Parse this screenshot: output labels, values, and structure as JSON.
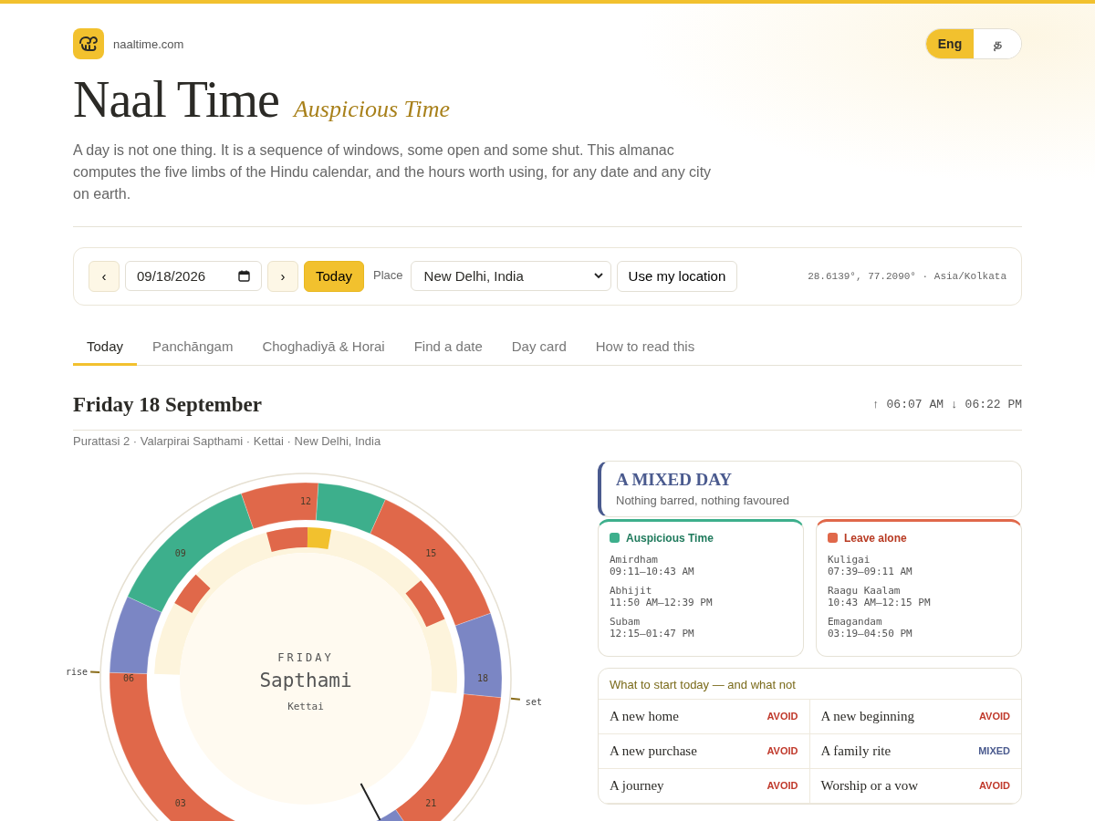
{
  "site": {
    "domain": "naaltime.com"
  },
  "languages": [
    {
      "label": "Eng",
      "selected": true
    },
    {
      "label": "த",
      "selected": false
    }
  ],
  "title": "Naal Time",
  "subtitle": "Auspicious Time",
  "intro": "A day is not one thing. It is a sequence of windows, some open and some shut. This almanac computes the five limbs of the Hindu calendar, and the hours worth using, for any date and any city on earth.",
  "controls": {
    "prev": "‹",
    "date": "09/18/2026",
    "next": "›",
    "today": "Today",
    "place_label": "Place",
    "place": "New Delhi, India",
    "locate": "Use my location",
    "coords": "28.6139°, 77.2090° · Asia/Kolkata"
  },
  "tabs": [
    {
      "label": "Today",
      "selected": true
    },
    {
      "label": "Panchāngam",
      "selected": false
    },
    {
      "label": "Choghadiyā & Horai",
      "selected": false
    },
    {
      "label": "Find a date",
      "selected": false
    },
    {
      "label": "Day card",
      "selected": false
    },
    {
      "label": "How to read this",
      "selected": false
    }
  ],
  "day": {
    "heading": "Friday 18 September",
    "sunrise": "↑ 06:07 AM",
    "sunset": "↓ 06:22 PM",
    "summary": "Purattasi 2 · Valarpirai Sapthami · Kettai · New Delhi, India"
  },
  "dial": {
    "hour_labels": [
      "12",
      "15",
      "18",
      "21",
      "03",
      "06",
      "09"
    ],
    "rise": "rise",
    "set": "set",
    "weekday": "FRIDAY",
    "tithi": "Sapthami",
    "star": "Kettai"
  },
  "verdict": {
    "title": "A MIXED DAY",
    "note": "Nothing barred, nothing favoured"
  },
  "windows": [
    {
      "kind": "good",
      "title": "Auspicious Time",
      "color": "#3daf8c",
      "items": [
        {
          "name": "Amirdham",
          "time": "09:11–10:43 AM"
        },
        {
          "name": "Abhijit",
          "time": "11:50 AM–12:39 PM"
        },
        {
          "name": "Subam",
          "time": "12:15–01:47 PM"
        }
      ]
    },
    {
      "kind": "bad",
      "title": "Leave alone",
      "color": "#e0684a",
      "items": [
        {
          "name": "Kuligai",
          "time": "07:39–09:11 AM"
        },
        {
          "name": "Raagu Kaalam",
          "time": "10:43 AM–12:15 PM"
        },
        {
          "name": "Emagandam",
          "time": "03:19–04:50 PM"
        }
      ]
    }
  ],
  "starts": {
    "title": "What to start today — and what not",
    "items": [
      {
        "activity": "A new home",
        "verdict": "AVOID",
        "kind": "avoid"
      },
      {
        "activity": "A new beginning",
        "verdict": "AVOID",
        "kind": "avoid"
      },
      {
        "activity": "A new purchase",
        "verdict": "AVOID",
        "kind": "avoid"
      },
      {
        "activity": "A family rite",
        "verdict": "MIXED",
        "kind": "mixed"
      },
      {
        "activity": "A journey",
        "verdict": "AVOID",
        "kind": "avoid"
      },
      {
        "activity": "Worship or a vow",
        "verdict": "AVOID",
        "kind": "avoid"
      }
    ]
  }
}
